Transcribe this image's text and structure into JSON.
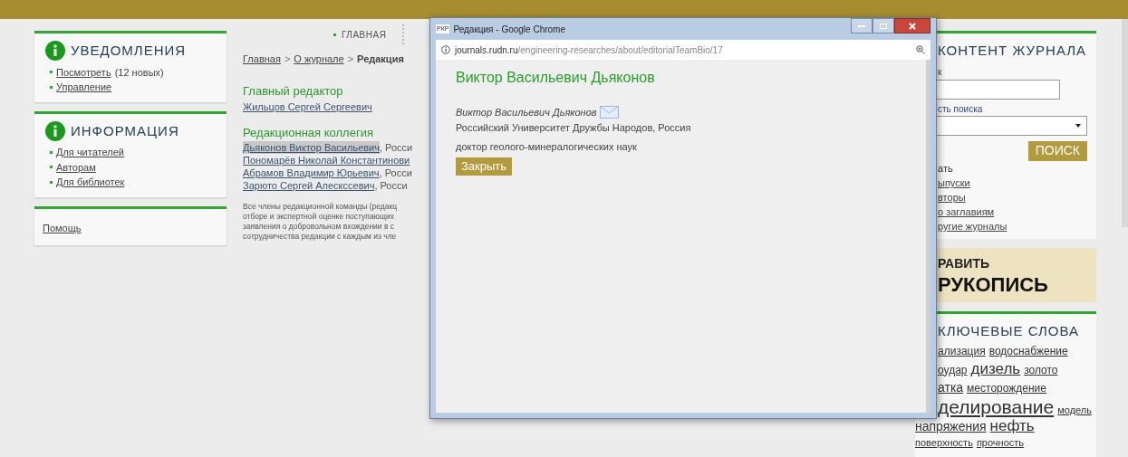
{
  "nav": {
    "items": [
      "ГЛАВНАЯ"
    ]
  },
  "notifications": {
    "title": "УВЕДОМЛЕНИЯ",
    "links": [
      {
        "label": "Посмотреть",
        "note": "(12 новых)"
      },
      {
        "label": "Управление"
      }
    ]
  },
  "information": {
    "title": "ИНФОРМАЦИЯ",
    "links": [
      "Для читателей",
      "Авторам",
      "Для библиотек"
    ]
  },
  "help": {
    "link": "Помощь"
  },
  "breadcrumb": {
    "links": [
      "Главная",
      "О журнале"
    ],
    "separators": [
      ">",
      ">"
    ],
    "current": "Редакция"
  },
  "editor_in_chief": {
    "heading": "Главный редактор",
    "name": "Жильцов Сергей Сергеевич"
  },
  "board": {
    "heading": "Редакционная коллегия",
    "members": [
      {
        "name": "Дьяконов Виктор Васильевич",
        "rest": ", Росси",
        "selected": true
      },
      {
        "name": "Пономарёв Николай Константинови",
        "selected": false
      },
      {
        "name": "Абрамов Владимир Юрьевич",
        "rest": ", Росси",
        "selected": false
      },
      {
        "name": "Зарюто Сергей Алескссевич",
        "rest": ", Росси",
        "selected": false
      }
    ]
  },
  "board_note": [
    "Все члены редакционной команды (редакц",
    "отборе и экспертной оценке поступающих",
    "заявления о добровольном вхождении в с",
    "сотрудничества редакции с каждым из чле"
  ],
  "popup": {
    "window_title": "Редакция - Google Chrome",
    "favicon": "РКР",
    "url_host": "journals.rudn.ru",
    "url_path": "/engineering-researches/about/editorialTeamBio/17",
    "heading": "Виктор Васильевич Дьяконов",
    "person": "Виктор Васильевич Дьяконов",
    "affiliation": "Российский Университет Дружбы Народов, Россия",
    "degree": "доктор геолого-минералогических наук",
    "close_button": "Закрыть"
  },
  "journal_content": {
    "title": "КОНТЕНТ ЖУРНАЛА",
    "search_label": "к",
    "scope_label": "сть поиска",
    "search_button": "ПОИСК",
    "browse_label": "ать",
    "browse_links": [
      "ыпуски",
      "вторы",
      "о заглавиям",
      "ругие журналы"
    ]
  },
  "banner": {
    "line_1": "РАВИТЬ",
    "line_2": "РУКОПИСЬ"
  },
  "keywords": {
    "title": "КЛЮЧЕВЫЕ СЛОВА",
    "lines": [
      [
        {
          "word": "ализация",
          "kind": "small"
        },
        {
          "word": "водоснабжение",
          "kind": "small"
        }
      ],
      [
        {
          "word": "оудар",
          "kind": "small"
        },
        {
          "word": "дизель",
          "kind": "large"
        },
        {
          "word": "золото",
          "kind": "small"
        }
      ],
      [
        {
          "word": "атка",
          "kind": "medium"
        },
        {
          "word": "месторождение",
          "kind": "small"
        }
      ],
      [
        {
          "word": "делирование",
          "kind": "huge"
        },
        {
          "word": "модель",
          "kind": "tiny"
        }
      ],
      [
        {
          "word": "напряжения",
          "kind": "medium"
        },
        {
          "word": "нефть",
          "kind": "large"
        }
      ],
      [
        {
          "word": "поверхность",
          "kind": "tiny"
        },
        {
          "word": "прочность",
          "kind": "tiny"
        }
      ]
    ]
  }
}
